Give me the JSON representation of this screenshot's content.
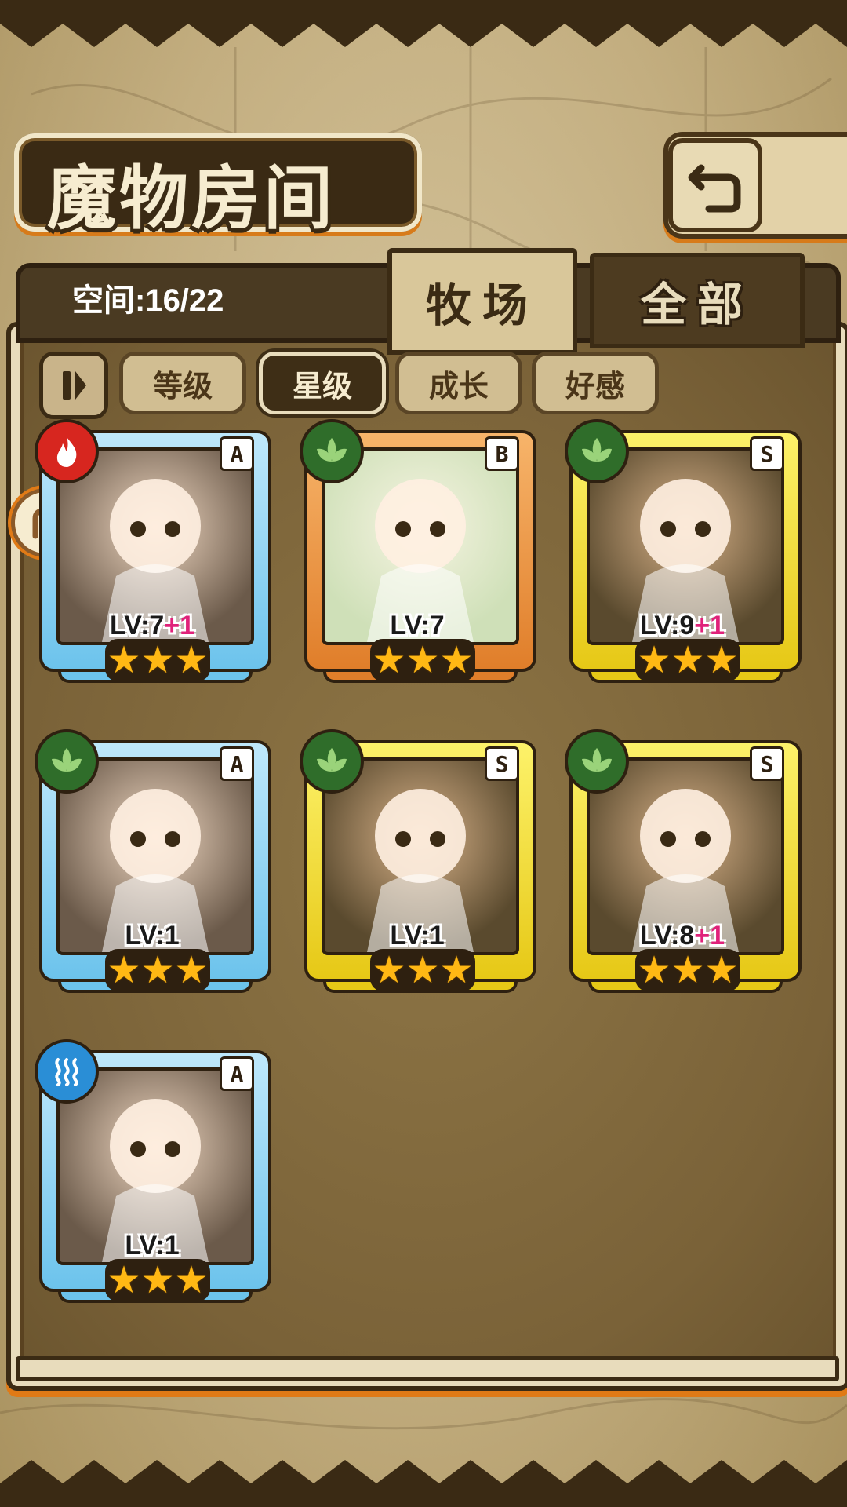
{
  "header": {
    "title": "魔物房间",
    "back_icon": "return-arrow-icon"
  },
  "tabs": {
    "ranch": "牧场",
    "all": "全部"
  },
  "space": {
    "label": "空间:16/22"
  },
  "sort": {
    "level": "等级",
    "star": "星级",
    "growth": "成长",
    "affinity": "好感",
    "selected": "星级"
  },
  "monsters": [
    {
      "rank": "A",
      "level": "LV:7",
      "bonus": "+1",
      "element": "fire-icon",
      "frame": "blue",
      "stars": 3
    },
    {
      "rank": "B",
      "level": "LV:7",
      "bonus": "",
      "element": "leaf-icon",
      "frame": "orange",
      "stars": 3
    },
    {
      "rank": "S",
      "level": "LV:9",
      "bonus": "+1",
      "element": "leaf-icon",
      "frame": "yellow",
      "stars": 3
    },
    {
      "rank": "A",
      "level": "LV:1",
      "bonus": "",
      "element": "leaf-icon",
      "frame": "blue",
      "stars": 3
    },
    {
      "rank": "S",
      "level": "LV:1",
      "bonus": "",
      "element": "leaf-icon",
      "frame": "yellow",
      "stars": 3
    },
    {
      "rank": "S",
      "level": "LV:8",
      "bonus": "+1",
      "element": "leaf-icon",
      "frame": "yellow",
      "stars": 3
    },
    {
      "rank": "A",
      "level": "LV:1",
      "bonus": "",
      "element": "water-icon",
      "frame": "blue",
      "stars": 3
    }
  ],
  "colors": {
    "accent_orange": "#e07a16",
    "frame_blue": "#6cc3ec",
    "frame_orange": "#e07e2a",
    "frame_yellow": "#e6c816",
    "fire": "#d7261f",
    "nature": "#2f6d2a",
    "water": "#2a8ed6",
    "bonus_pink": "#e0227a"
  }
}
